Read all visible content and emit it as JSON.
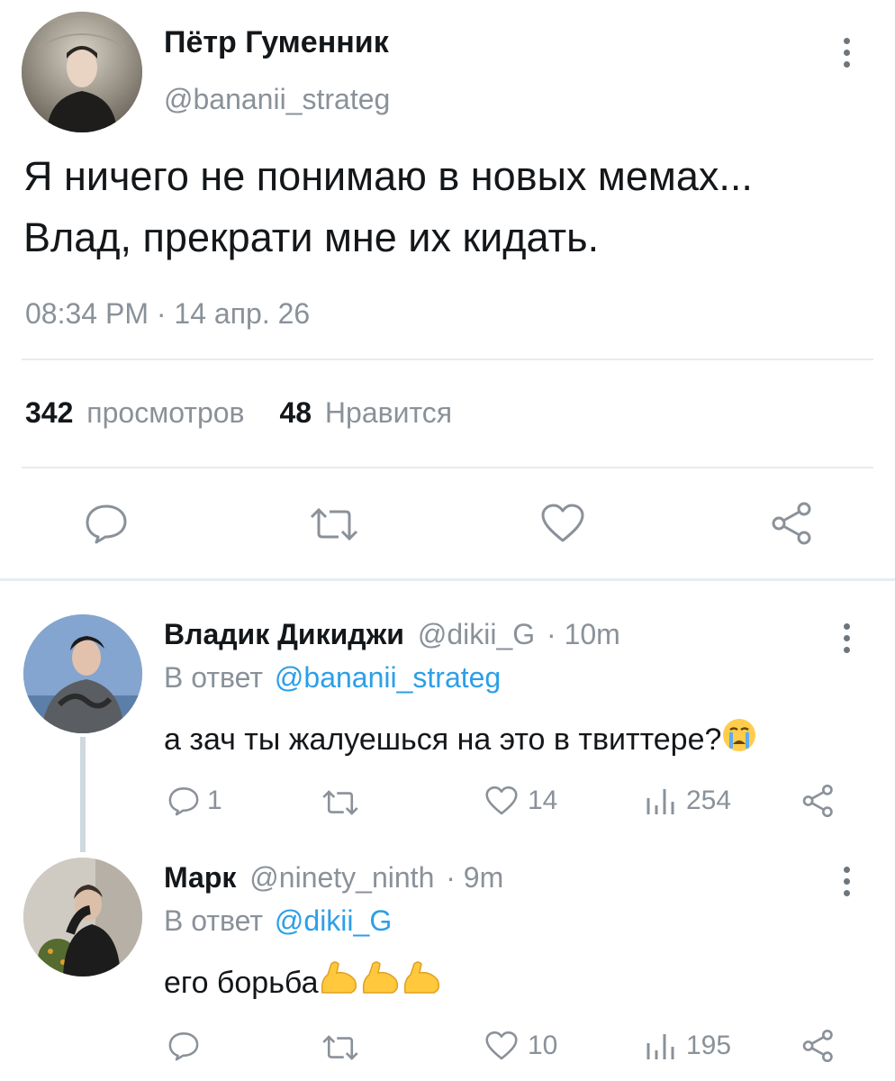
{
  "main_tweet": {
    "author_name": "Пётр Гуменник",
    "author_handle": "@bananii_strateg",
    "text_line1": "Я ничего не понимаю в новых мемах...",
    "text_line2": "Влад, прекрати мне их кидать.",
    "time": "08:34 PM · 14 апр. 26",
    "views_count": "342",
    "views_label": "просмотров",
    "likes_count": "48",
    "likes_label": "Нравится"
  },
  "replies": [
    {
      "author_name": "Владик Дикиджи",
      "author_handle": "@dikii_G",
      "time": "· 10m",
      "reply_prefix": "В ответ",
      "reply_to": "@bananii_strateg",
      "text": "а зач ты жалуешься на это в твиттере?",
      "emoji": "crying-face",
      "replies_count": "1",
      "likes_count": "14",
      "views_count": "254"
    },
    {
      "author_name": "Марк",
      "author_handle": "@ninety_ninth",
      "time": "· 9m",
      "reply_prefix": "В ответ",
      "reply_to": "@dikii_G",
      "text": "его борьба",
      "emoji": "flexed-biceps",
      "likes_count": "10",
      "views_count": "195"
    }
  ],
  "colors": {
    "link": "#2c9fe8",
    "grey_text": "#8a9199",
    "icon_grey": "#8a9199",
    "divider": "#e6ecf0"
  }
}
